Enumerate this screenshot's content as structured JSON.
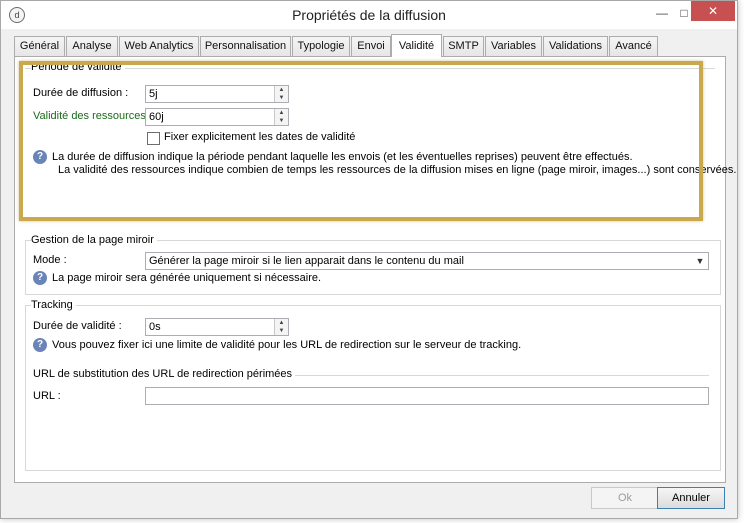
{
  "window": {
    "title": "Propriétés de la diffusion"
  },
  "tabs": [
    {
      "label": "Général"
    },
    {
      "label": "Analyse"
    },
    {
      "label": "Web Analytics"
    },
    {
      "label": "Personnalisation"
    },
    {
      "label": "Typologie"
    },
    {
      "label": "Envoi"
    },
    {
      "label": "Validité"
    },
    {
      "label": "SMTP"
    },
    {
      "label": "Variables"
    },
    {
      "label": "Validations"
    },
    {
      "label": "Avancé"
    }
  ],
  "validity": {
    "title": "Période de validité",
    "duration_label": "Durée de diffusion :",
    "duration_value": "5j",
    "resources_label": "Validité des ressources :",
    "resources_value": "60j",
    "checkbox_label": "Fixer explicitement les dates de validité",
    "help_line1": "La durée de diffusion indique la période pendant laquelle les envois (et les éventuelles reprises) peuvent être effectués.",
    "help_line2": "La validité des ressources indique combien de temps les ressources de la diffusion mises en ligne (page miroir, images...) sont conservées."
  },
  "mirror": {
    "title": "Gestion de la page miroir",
    "mode_label": "Mode :",
    "mode_value": "Générer la page miroir si le lien apparait dans le contenu du mail",
    "help": "La page miroir sera générée uniquement si nécessaire."
  },
  "tracking": {
    "title": "Tracking",
    "validity_label": "Durée de validité :",
    "validity_value": "0s",
    "help": "Vous pouvez fixer ici une limite de validité pour les URL de redirection sur le serveur de tracking.",
    "url_section_title": "URL de substitution des URL de redirection périmées",
    "url_label": "URL :",
    "url_value": ""
  },
  "buttons": {
    "ok": "Ok",
    "cancel": "Annuler"
  },
  "colors": {
    "highlight": "#c9a84e",
    "close": "#c75050",
    "help": "#6b84b8"
  }
}
